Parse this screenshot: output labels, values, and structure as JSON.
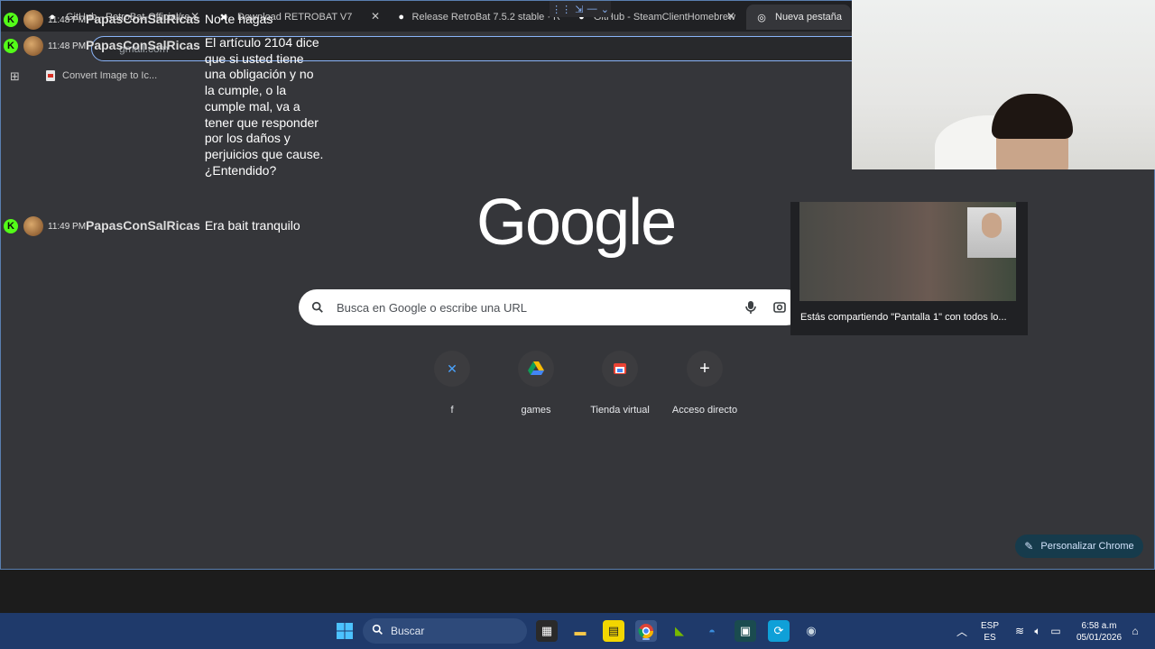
{
  "tabs": [
    {
      "title": "GitHub - RetroBat-Official/re",
      "icon": "github-icon"
    },
    {
      "title": "Download RETROBAT V7",
      "icon": "x-icon"
    },
    {
      "title": "Release RetroBat 7.5.2 stable · R",
      "icon": "github-icon"
    },
    {
      "title": "GitHub - SteamClientHomebrew",
      "icon": "github-icon"
    },
    {
      "title": "Nueva pestaña",
      "icon": "chrome-icon"
    }
  ],
  "omnibox": {
    "text": "gmail.com"
  },
  "bookmarks": [
    {
      "label": "Convert Image to Ic..."
    }
  ],
  "google": {
    "logo": "Google",
    "search_placeholder": "Busca en Google o escribe una URL"
  },
  "shortcuts": [
    {
      "label": "f"
    },
    {
      "label": "games"
    },
    {
      "label": "Tienda virtual"
    },
    {
      "label": "Acceso directo"
    }
  ],
  "customize_label": "Personalizar Chrome",
  "chat": [
    {
      "time": "11:48 PM",
      "user": "PapasConSalRicas",
      "message": "No te hagas"
    },
    {
      "time": "11:48 PM",
      "user": "PapasConSalRicas",
      "message": "El artículo 2104 dice que si usted tiene una obligación y no la cumple, o la cumple mal, va a tener que responder por los daños y perjuicios que cause. ¿Entendido?"
    },
    {
      "time": "11:49 PM",
      "user": "PapasConSalRicas",
      "message": "Era bait tranquilo"
    }
  ],
  "share_popup": {
    "caption": "Estás compartiendo \"Pantalla 1\" con todos lo..."
  },
  "taskbar": {
    "search_label": "Buscar",
    "lang_top": "ESP",
    "lang_bottom": "ES",
    "time": "6:58 a.m",
    "date": "05/01/2026"
  },
  "colors": {
    "accent": "#8ab4f8",
    "kick_green": "#53fc18",
    "taskbar": "#1f3a6b"
  }
}
